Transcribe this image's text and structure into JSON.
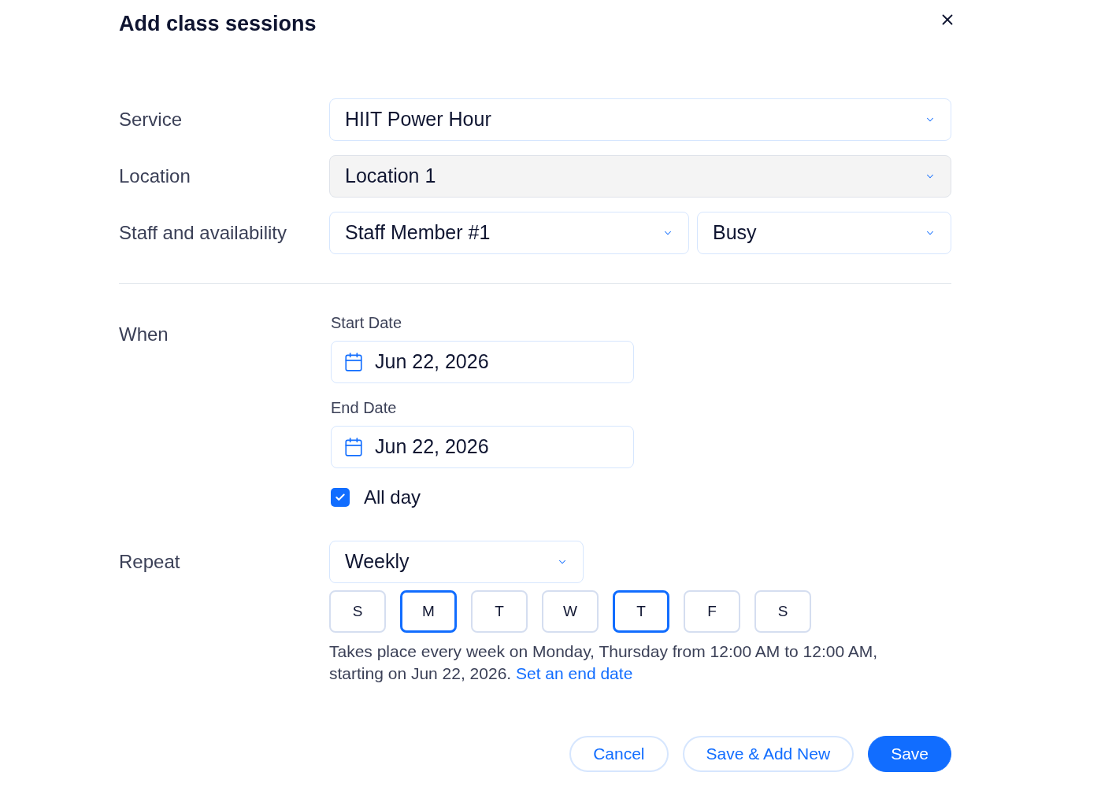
{
  "dialog": {
    "title": "Add class sessions"
  },
  "rows": [
    {
      "label": "Service",
      "selects": [
        {
          "value": "HIIT Power Hour",
          "disabled": false
        }
      ]
    },
    {
      "label": "Location",
      "selects": [
        {
          "value": "Location 1",
          "disabled": true
        }
      ]
    },
    {
      "label": "Staff and availability",
      "selects": [
        {
          "value": "Staff Member #1",
          "disabled": false
        },
        {
          "value": "Busy",
          "disabled": false
        }
      ]
    }
  ],
  "when": {
    "label": "When",
    "dates": [
      {
        "label": "Start Date",
        "value": "Jun 22, 2026"
      },
      {
        "label": "End Date",
        "value": "Jun 22, 2026"
      }
    ],
    "all_day": {
      "label": "All day",
      "checked": true
    }
  },
  "repeat": {
    "label": "Repeat",
    "value": "Weekly",
    "days": [
      {
        "label": "S",
        "selected": false
      },
      {
        "label": "M",
        "selected": true
      },
      {
        "label": "T",
        "selected": false
      },
      {
        "label": "W",
        "selected": false
      },
      {
        "label": "T",
        "selected": true
      },
      {
        "label": "F",
        "selected": false
      },
      {
        "label": "S",
        "selected": false
      }
    ],
    "summary": "Takes place every week on Monday, Thursday from 12:00 AM to 12:00 AM, starting on Jun 22, 2026.",
    "link": "Set an end date"
  },
  "buttons": [
    {
      "label": "Cancel",
      "kind": "secondary"
    },
    {
      "label": "Save & Add New",
      "kind": "secondary"
    },
    {
      "label": "Save",
      "kind": "primary"
    }
  ]
}
